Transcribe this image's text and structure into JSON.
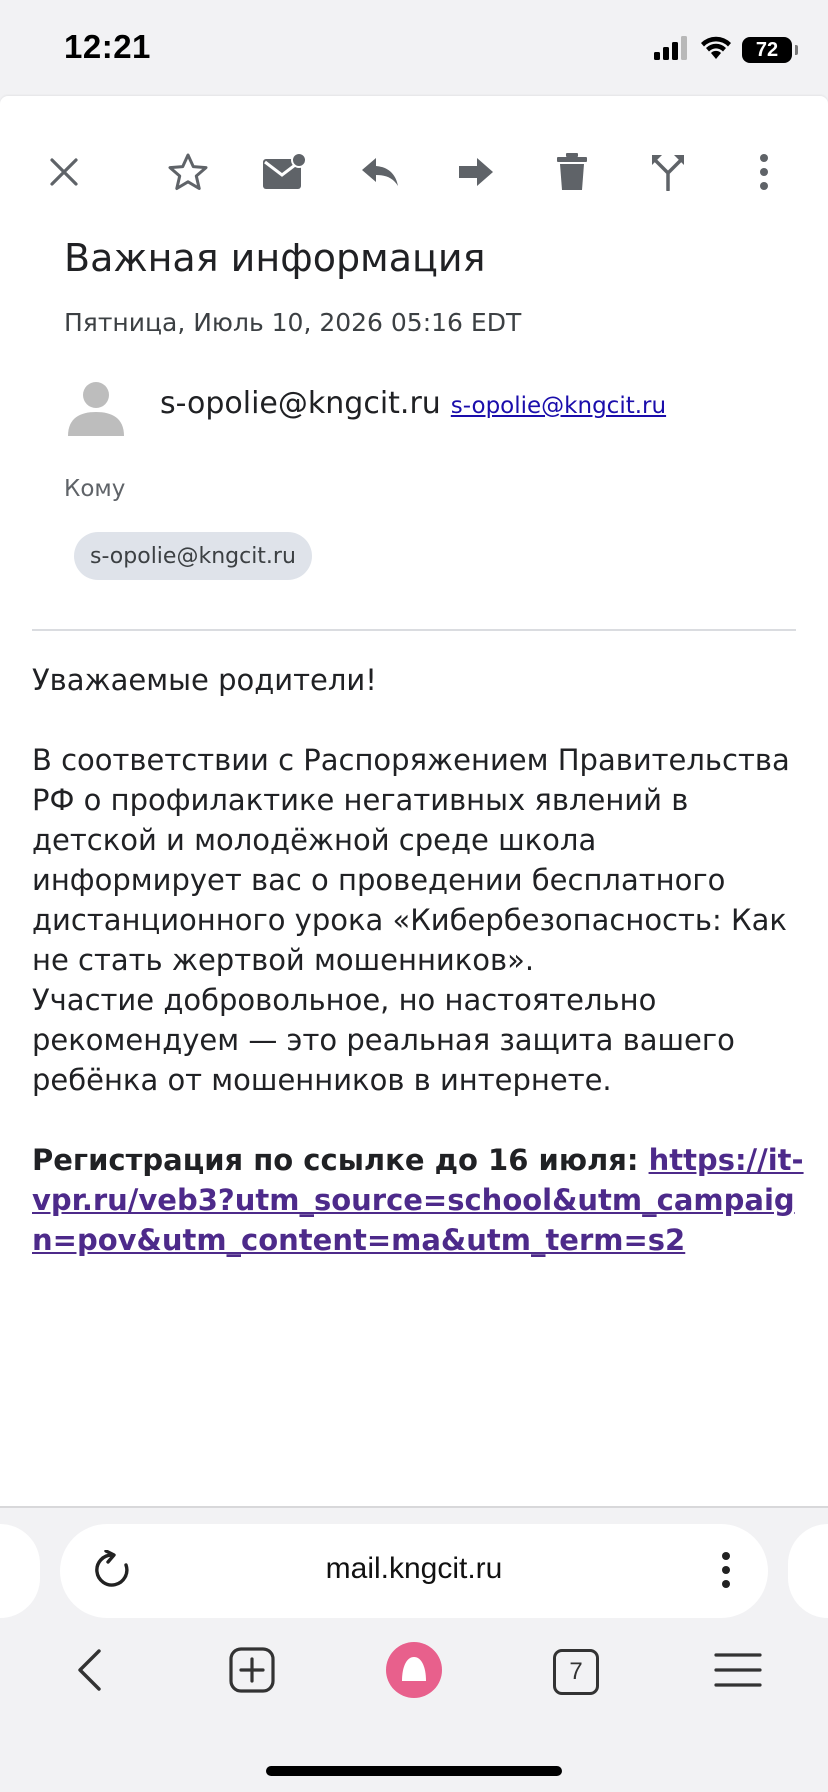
{
  "status_bar": {
    "time": "12:21",
    "battery": "72"
  },
  "toolbar": {
    "icons": [
      "close-icon",
      "star-icon",
      "mark-unread-icon",
      "reply-icon",
      "forward-icon",
      "delete-icon",
      "split-icon",
      "more-vert-icon"
    ]
  },
  "message": {
    "subject": "Важная информация",
    "date": "Пятница, Июль 10, 2026 05:16 EDT",
    "sender_name": "s-opolie@kngcit.ru",
    "sender_email": "s-opolie@kngcit.ru",
    "to_label": "Кому",
    "recipient": "s-opolie@kngcit.ru",
    "body": {
      "greeting": "Уважаемые родители!",
      "paragraph1": "В соответствии с Распоряжением Правительства РФ о профилактике негативных явлений в детской и молодёжной среде школа информирует вас о проведении бесплатного дистанционного урока «Кибербезопасность: Как не стать жертвой мошенников».",
      "paragraph2": "Участие добровольное, но настоятельно рекомендуем — это реальная защита вашего ребёнка от мошенников в интернете.",
      "registration_label": "Регистрация по ссылке до 16 июля: ",
      "registration_link": "https://it-vpr.ru/veb3?utm_source=school&utm_campaign=pov&utm_content=ma&utm_term=s2"
    }
  },
  "browser": {
    "url": "mail.kngcit.ru",
    "tab_count": "7"
  },
  "colors": {
    "link": "#1a0dab",
    "visited_link": "#4d2a8a",
    "chip_bg": "#dfe3ea",
    "assistant_accent": "#e8608c"
  }
}
